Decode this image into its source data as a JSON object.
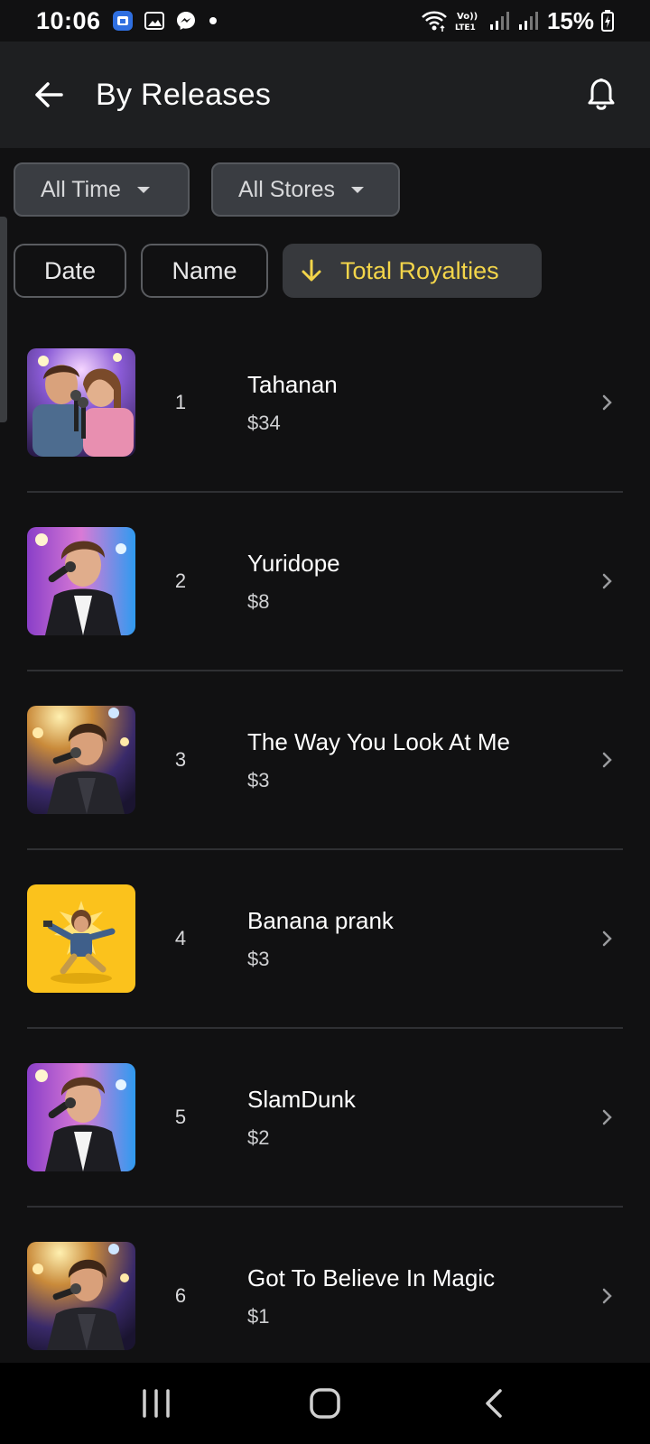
{
  "status_bar": {
    "time": "10:06",
    "battery": "15%",
    "network": "Vo)) LTE1"
  },
  "header": {
    "title": "By Releases"
  },
  "filters": {
    "time": "All Time",
    "stores": "All Stores"
  },
  "sort": {
    "date": "Date",
    "name": "Name",
    "royalties": "Total Royalties",
    "active": "royalties",
    "active_color": "#f3d54a"
  },
  "releases": [
    {
      "rank": "1",
      "title": "Tahanan",
      "amount": "$34",
      "cover": "duet-karaoke"
    },
    {
      "rank": "2",
      "title": "Yuridope",
      "amount": "$8",
      "cover": "singer-blue"
    },
    {
      "rank": "3",
      "title": "The Way You Look At Me",
      "amount": "$3",
      "cover": "singer-stage"
    },
    {
      "rank": "4",
      "title": "Banana prank",
      "amount": "$3",
      "cover": "yellow-jump"
    },
    {
      "rank": "5",
      "title": "SlamDunk",
      "amount": "$2",
      "cover": "singer-blue"
    },
    {
      "rank": "6",
      "title": "Got To Believe In Magic",
      "amount": "$1",
      "cover": "singer-stage"
    }
  ],
  "colors": {
    "background": "#111112",
    "header_bg": "#1e1f21",
    "accent": "#f3d54a"
  }
}
